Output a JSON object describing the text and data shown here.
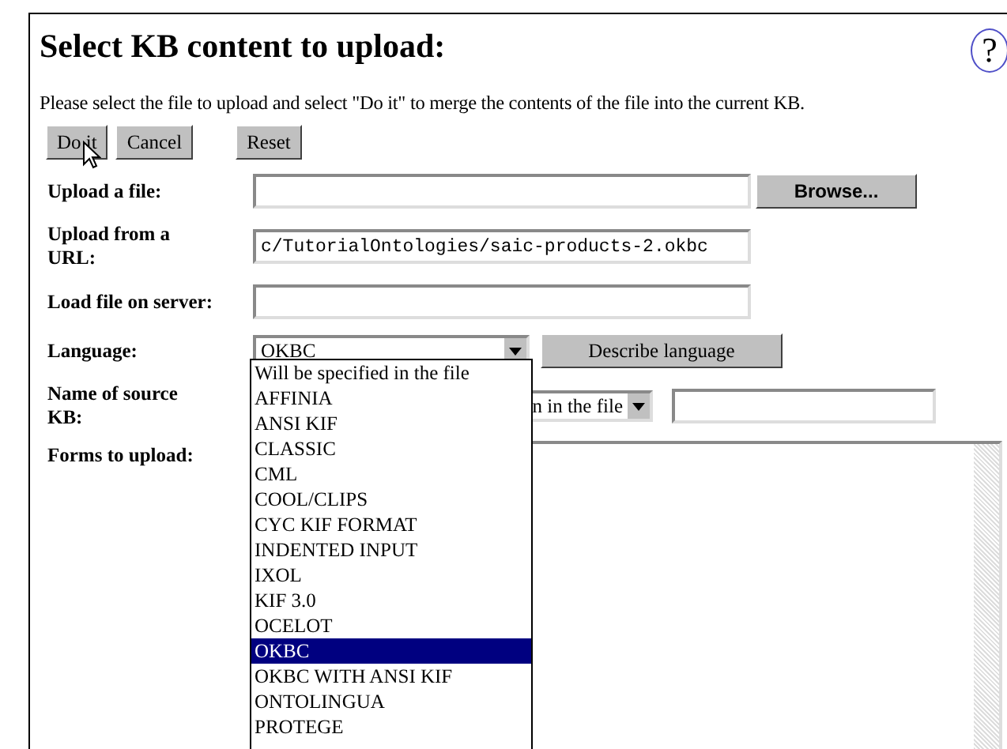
{
  "title": "Select KB content to upload:",
  "help_icon": "?",
  "instructions": "Please select the file to upload and select \"Do it\" to merge the contents of the file into the current KB.",
  "action_buttons": [
    "Do it",
    "Cancel"
  ],
  "reset_button": "Reset",
  "upload_file": {
    "label": "Upload a file:",
    "browse_button": "Browse..."
  },
  "upload_url": {
    "label": "Upload from a URL:",
    "value": "c/TutorialOntologies/saic-products-2.okbc"
  },
  "server_file": {
    "label": "Load file on server:"
  },
  "language": {
    "label": "Language:",
    "value": "OKBC",
    "expanded": true,
    "describe_button": "Describe language",
    "options": [
      {
        "label": "Will be specified in the file",
        "selected": false
      },
      {
        "label": "AFFINIA",
        "selected": false
      },
      {
        "label": "ANSI KIF",
        "selected": false
      },
      {
        "label": "CLASSIC",
        "selected": false
      },
      {
        "label": "CML",
        "selected": false
      },
      {
        "label": "COOL/CLIPS",
        "selected": false
      },
      {
        "label": "CYC KIF FORMAT",
        "selected": false
      },
      {
        "label": "INDENTED INPUT",
        "selected": false
      },
      {
        "label": "IXOL",
        "selected": false
      },
      {
        "label": "KIF 3.0",
        "selected": false
      },
      {
        "label": "OCELOT",
        "selected": false
      },
      {
        "label": "OKBC",
        "selected": true
      },
      {
        "label": "OKBC WITH ANSI KIF",
        "selected": false
      },
      {
        "label": "ONTOLINGUA",
        "selected": false
      },
      {
        "label": "PROTEGE",
        "selected": false
      }
    ]
  },
  "source_kb": {
    "label": "Name of source KB:",
    "select_value": "n in the file"
  },
  "forms": {
    "label": "Forms to upload:"
  }
}
